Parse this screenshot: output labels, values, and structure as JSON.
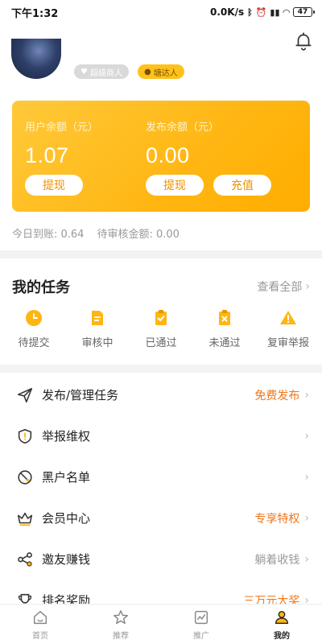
{
  "status_bar": {
    "time": "下午1:32",
    "speed": "0.0K/s",
    "icons": [
      "bluetooth-icon",
      "alarm-icon",
      "signal-icon",
      "wifi-icon"
    ],
    "battery": "47"
  },
  "profile": {
    "badge_super": "超级商人",
    "badge_talent": "塘达人"
  },
  "balance_card": {
    "user_balance_label": "用户余额（元）",
    "user_balance_value": "1.07",
    "publish_balance_label": "发布余额（元）",
    "publish_balance_value": "0.00",
    "withdraw_label": "提现",
    "withdraw2_label": "提现",
    "recharge_label": "充值"
  },
  "summary": {
    "today": "今日到账: 0.64",
    "pending": "待审核金额: 0.00"
  },
  "tasks": {
    "title": "我的任务",
    "view_all": "查看全部",
    "items": [
      {
        "label": "待提交",
        "icon": "clock-icon"
      },
      {
        "label": "审核中",
        "icon": "document-icon"
      },
      {
        "label": "已通过",
        "icon": "check-clipboard-icon"
      },
      {
        "label": "未通过",
        "icon": "cross-clipboard-icon"
      },
      {
        "label": "复审举报",
        "icon": "warning-icon"
      }
    ]
  },
  "menu": [
    {
      "label": "发布/管理任务",
      "right": "免费发布",
      "icon": "paper-plane-icon"
    },
    {
      "label": "举报维权",
      "right": "",
      "icon": "shield-icon"
    },
    {
      "label": "黑户名单",
      "right": "",
      "icon": "ban-icon"
    },
    {
      "label": "会员中心",
      "right": "专享特权",
      "icon": "crown-icon"
    },
    {
      "label": "邀友赚钱",
      "right": "躺着收钱",
      "icon": "share-icon"
    },
    {
      "label": "排名奖励",
      "right": "三万元大奖",
      "icon": "trophy-icon"
    }
  ],
  "tabbar": [
    {
      "label": "首页",
      "icon": "home-icon"
    },
    {
      "label": "推荐",
      "icon": "star-icon"
    },
    {
      "label": "推广",
      "icon": "chart-icon"
    },
    {
      "label": "我的",
      "icon": "user-icon"
    }
  ],
  "colors": {
    "accent": "#ffb612",
    "orange_text": "#f0761a"
  }
}
